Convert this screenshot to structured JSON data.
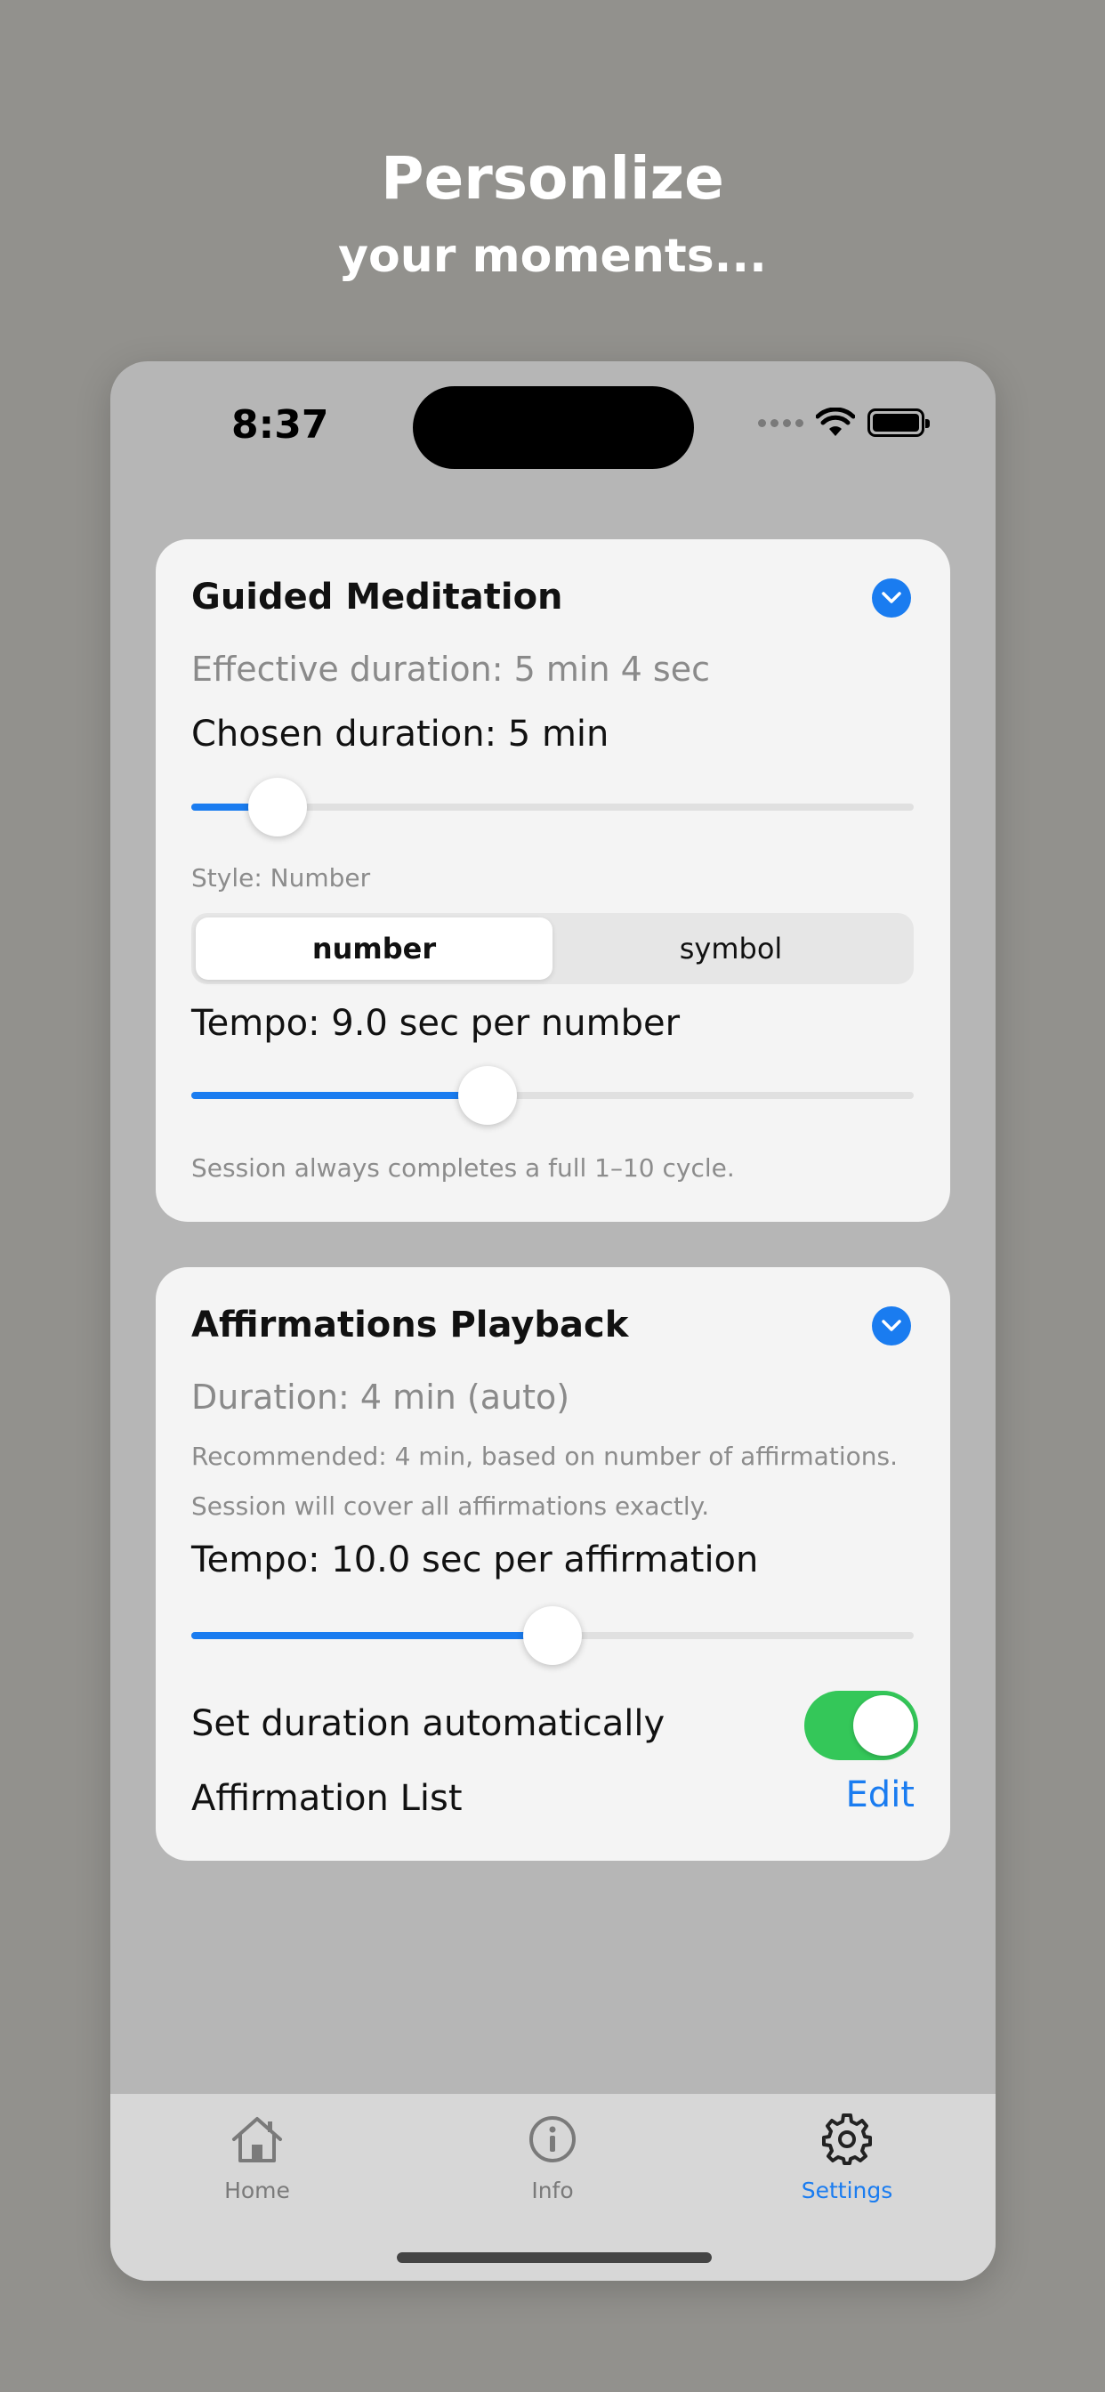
{
  "promo": {
    "line1": "Personlize",
    "line2": "your moments..."
  },
  "status_bar": {
    "time": "8:37"
  },
  "guided_meditation": {
    "title": "Guided Meditation",
    "effective_duration": "Effective duration: 5 min 4 sec",
    "chosen_duration": "Chosen duration: 5 min",
    "duration_slider_value": 0.12,
    "style_label": "Style: Number",
    "style_options": [
      "number",
      "symbol"
    ],
    "style_selected": "number",
    "tempo": "Tempo: 9.0 sec per number",
    "tempo_slider_value": 0.41,
    "note": "Session always completes a full 1–10 cycle."
  },
  "affirmations": {
    "title": "Affirmations Playback",
    "duration": "Duration: 4 min (auto)",
    "recommended": "Recommended: 4 min, based on number of affirmations.",
    "coverage": "Session will cover all affirmations exactly.",
    "tempo": "Tempo: 10.0 sec per affirmation",
    "tempo_slider_value": 0.5,
    "auto_duration_label": "Set duration automatically",
    "auto_duration_on": true,
    "list_label": "Affirmation List",
    "edit_label": "Edit"
  },
  "tab_bar": {
    "tabs": [
      {
        "label": "Home",
        "icon": "house-icon"
      },
      {
        "label": "Info",
        "icon": "info-circle-icon"
      },
      {
        "label": "Settings",
        "icon": "gear-icon"
      }
    ],
    "active": "Settings"
  },
  "colors": {
    "accent": "#1a7cf0",
    "toggle_on": "#34c759",
    "background": "#92918d"
  }
}
